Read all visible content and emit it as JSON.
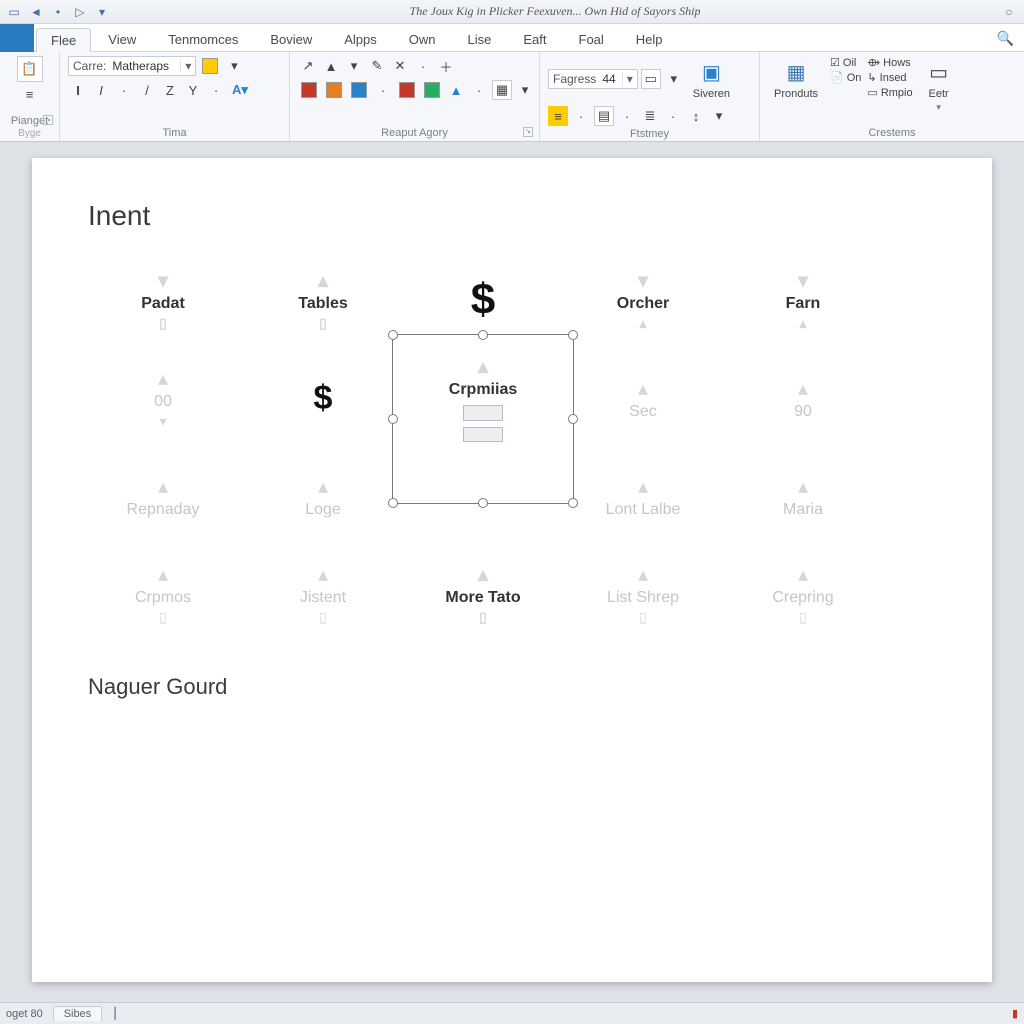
{
  "titlebar": {
    "title": "The Joux Kig in Plicker Feexuven... Own Hid of Sayors Ship"
  },
  "tabs": {
    "items": [
      "Flee",
      "View",
      "Tenmomces",
      "Boview",
      "Alpps",
      "Own",
      "Lise",
      "Eaft",
      "Foal",
      "Help"
    ],
    "active": 0
  },
  "ribbon": {
    "group0": {
      "label": "Pianget",
      "sublabel": "Byge"
    },
    "font": {
      "label": "Carre:",
      "value": "Matheraps",
      "buttons": [
        "I",
        "I",
        "/",
        "Z",
        "Y"
      ],
      "group_label": "Tima"
    },
    "report": {
      "group_label": "Reaput Agory"
    },
    "paragraph": {
      "fagress_label": "Fagress",
      "fagress_value": "44",
      "group_label": "Ftstmey",
      "sweren": "Siveren"
    },
    "customs": {
      "group_label": "Crestems",
      "pronduts": "Pronduts",
      "oil": "Oil",
      "on": "On",
      "hows": "Hows",
      "insed": "Insed",
      "rmpio": "Rmpio",
      "eetr": "Eetr"
    }
  },
  "doc": {
    "heading1": "Inent",
    "heading2": "Naguer Gourd",
    "grid": {
      "r1": [
        "Padat",
        "Tables",
        "$",
        "Orcher",
        "Farn"
      ],
      "r2": [
        "00",
        "$",
        "Crpmiias",
        "Sec",
        "90"
      ],
      "r3": [
        "Repnaday",
        "Loge",
        "",
        "Lont Lalbe",
        "Maria"
      ],
      "r4": [
        "Crpmos",
        "Jistent",
        "More Tato",
        "List Shrep",
        "Crepring"
      ]
    }
  },
  "status": {
    "left": "oget 80",
    "tab": "Sibes"
  }
}
